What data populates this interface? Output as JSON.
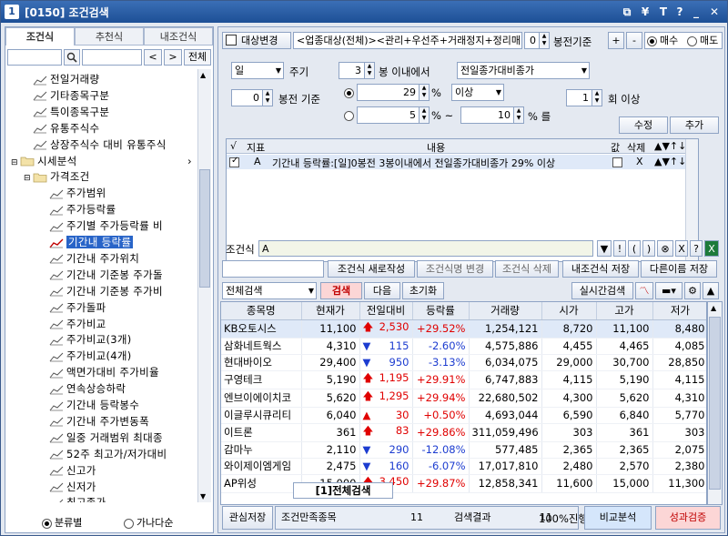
{
  "window": {
    "num": "1",
    "title": "[0150] 조건검색"
  },
  "left": {
    "tabs": [
      "조건식",
      "추천식",
      "내조건식"
    ],
    "search_btn": "전체",
    "tree": [
      {
        "label": "전일거래량",
        "indent": 2,
        "type": "item"
      },
      {
        "label": "기타종목구분",
        "indent": 2,
        "type": "item"
      },
      {
        "label": "특이종목구분",
        "indent": 2,
        "type": "item"
      },
      {
        "label": "유통주식수",
        "indent": 2,
        "type": "item"
      },
      {
        "label": "상장주식수 대비 유통주식",
        "indent": 2,
        "type": "item"
      },
      {
        "label": "시세분석",
        "indent": 0,
        "type": "folder"
      },
      {
        "label": "가격조건",
        "indent": 1,
        "type": "folder"
      },
      {
        "label": "주가범위",
        "indent": 3,
        "type": "item"
      },
      {
        "label": "주가등락률",
        "indent": 3,
        "type": "item"
      },
      {
        "label": "주기별 주가등락률 비",
        "indent": 3,
        "type": "item"
      },
      {
        "label": "기간내 등락률",
        "indent": 3,
        "type": "item",
        "selected": true
      },
      {
        "label": "기간내 주가위치",
        "indent": 3,
        "type": "item"
      },
      {
        "label": "기간내 기준봉 주가돌",
        "indent": 3,
        "type": "item"
      },
      {
        "label": "기간내 기준봉 주가비",
        "indent": 3,
        "type": "item"
      },
      {
        "label": "주가돌파",
        "indent": 3,
        "type": "item"
      },
      {
        "label": "주가비교",
        "indent": 3,
        "type": "item"
      },
      {
        "label": "주가비교(3개)",
        "indent": 3,
        "type": "item"
      },
      {
        "label": "주가비교(4개)",
        "indent": 3,
        "type": "item"
      },
      {
        "label": "액면가대비 주가비율",
        "indent": 3,
        "type": "item"
      },
      {
        "label": "연속상승하락",
        "indent": 3,
        "type": "item"
      },
      {
        "label": "기간내 등락봉수",
        "indent": 3,
        "type": "item"
      },
      {
        "label": "기간내 주가변동폭",
        "indent": 3,
        "type": "item"
      },
      {
        "label": "일중 거래범위 최대종",
        "indent": 3,
        "type": "item"
      },
      {
        "label": "52주 최고가/저가대비",
        "indent": 3,
        "type": "item"
      },
      {
        "label": "신고가",
        "indent": 3,
        "type": "item"
      },
      {
        "label": "신저가",
        "indent": 3,
        "type": "item"
      },
      {
        "label": "최고종가",
        "indent": 3,
        "type": "item"
      }
    ],
    "radio1": "분류별",
    "radio2": "가나다순"
  },
  "top": {
    "change_target": "대상변경",
    "target_text": "<업종대상(전체)><관리+우선주+거래정지+정리매",
    "bong_value": "0",
    "bong_label": "봉전기준",
    "plus": "+",
    "minus": "-",
    "buy": "매수",
    "sell": "매도",
    "period": "일",
    "period_label": "주기",
    "n_bong": "3",
    "n_bong_label": "봉 이내에서",
    "compare": "전일종가대비종가",
    "base_bong": "0",
    "base_bong_label": "봉전 기준",
    "pct1": "29",
    "pct_sym": "%",
    "cond1": "이상",
    "times": "1",
    "times_label": "회 이상",
    "pct2a": "5",
    "pct_range": "% ~",
    "pct2b": "10",
    "pct_end": "% 를",
    "modify": "수정",
    "add": "추가"
  },
  "condgrid": {
    "headers": [
      "√",
      "지표",
      "내용",
      "값",
      "삭제"
    ],
    "row": {
      "check": true,
      "id": "A",
      "text": "기간내 등락률:[일]0봉전 3봉이내에서 전일종가대비종가 29% 이상",
      "del": "X"
    }
  },
  "condbar": {
    "label": "조건식",
    "value": "A"
  },
  "actions": [
    "조건식 새로작성",
    "조건식명 변경",
    "조건식 삭제",
    "내조건식 저장",
    "다른이름 저장"
  ],
  "search": {
    "scope": "전체검색",
    "search": "검색",
    "next": "다음",
    "reset": "초기화",
    "realtime": "실시간검색"
  },
  "table": {
    "headers": [
      "종목명",
      "현재가",
      "전일대비",
      "등락률",
      "거래량",
      "시가",
      "고가",
      "저가"
    ],
    "rows": [
      {
        "name": "KB오토시스",
        "price": "11,100",
        "dir": "up",
        "chg": "2,530",
        "rate": "+29.52%",
        "vol": "1,254,121",
        "open": "8,720",
        "high": "11,100",
        "low": "8,480"
      },
      {
        "name": "삼화네트웍스",
        "price": "4,310",
        "dir": "dn",
        "chg": "115",
        "rate": "-2.60%",
        "vol": "4,575,886",
        "open": "4,455",
        "high": "4,465",
        "low": "4,085"
      },
      {
        "name": "현대바이오",
        "price": "29,400",
        "dir": "dn",
        "chg": "950",
        "rate": "-3.13%",
        "vol": "6,034,075",
        "open": "29,000",
        "high": "30,700",
        "low": "28,850"
      },
      {
        "name": "구영테크",
        "price": "5,190",
        "dir": "up",
        "chg": "1,195",
        "rate": "+29.91%",
        "vol": "6,747,883",
        "open": "4,115",
        "high": "5,190",
        "low": "4,115"
      },
      {
        "name": "엔브이에이치코",
        "price": "5,620",
        "dir": "up",
        "chg": "1,295",
        "rate": "+29.94%",
        "vol": "22,680,502",
        "open": "4,300",
        "high": "5,620",
        "low": "4,310"
      },
      {
        "name": "이글루시큐리티",
        "price": "6,040",
        "dir": "up2",
        "chg": "30",
        "rate": "+0.50%",
        "vol": "4,693,044",
        "open": "6,590",
        "high": "6,840",
        "low": "5,770"
      },
      {
        "name": "이트론",
        "price": "361",
        "dir": "up",
        "chg": "83",
        "rate": "+29.86%",
        "vol": "311,059,496",
        "open": "303",
        "high": "361",
        "low": "303"
      },
      {
        "name": "감마누",
        "price": "2,110",
        "dir": "dn",
        "chg": "290",
        "rate": "-12.08%",
        "vol": "577,485",
        "open": "2,365",
        "high": "2,365",
        "low": "2,075"
      },
      {
        "name": "와이제이엠게임",
        "price": "2,475",
        "dir": "dn",
        "chg": "160",
        "rate": "-6.07%",
        "vol": "17,017,810",
        "open": "2,480",
        "high": "2,570",
        "low": "2,380"
      },
      {
        "name": "AP위성",
        "price": "15,000",
        "dir": "up",
        "chg": "3,450",
        "rate": "+29.87%",
        "vol": "12,858,341",
        "open": "11,600",
        "high": "15,000",
        "low": "11,300"
      }
    ]
  },
  "bottom_tab": "[1]전체검색",
  "status": {
    "save": "관심저장",
    "match_label": "조건만족종목",
    "match": "11",
    "result_label": "검색결과",
    "result": "11",
    "progress": "100%진행",
    "progress_pct": 100,
    "compare": "비교분석",
    "verify": "성과검증"
  },
  "colors": {
    "up": "#e00000",
    "down": "#1c3cd0",
    "selected": "#2864c8",
    "title": "#1d4f96"
  }
}
